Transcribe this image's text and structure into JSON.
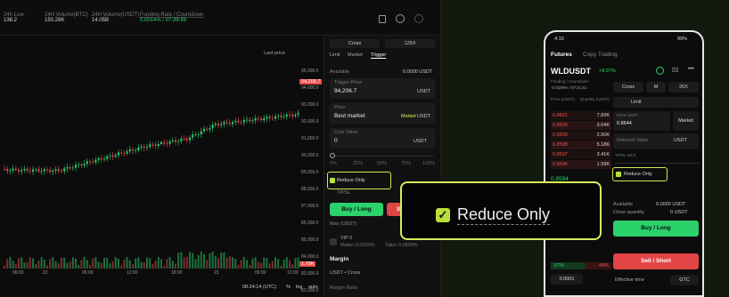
{
  "topbar": {
    "stats": [
      {
        "label": "24h Low",
        "value": "138.2"
      },
      {
        "label": "24H Volume(BTC)",
        "value": "150.28K"
      },
      {
        "label": "24H Volume(USDT)",
        "value": "14.05B"
      },
      {
        "label": "Funding Rate / Countdown",
        "value": "0.0014% / 07:39:48"
      }
    ]
  },
  "chart": {
    "price_type": "Last price",
    "y_ticks": [
      "95,000.0",
      "94,000.0",
      "93,000.0",
      "92,000.0",
      "91,000.0",
      "90,000.0",
      "89,000.0",
      "88,000.0",
      "87,000.0",
      "86,000.0",
      "85,000.0",
      "84,000.0",
      "83,000.0",
      "82,000.0"
    ],
    "last_price": "94,206.7",
    "x_ticks": [
      "06:00",
      "22",
      "06:00",
      "12:00",
      "18:00",
      "23",
      "06:00",
      "12:00"
    ],
    "vol_tag": "1.79K",
    "time_display": "08:24:14 (UTC)",
    "scale_opts": [
      "%",
      "log",
      "auto"
    ]
  },
  "order": {
    "margin_mode": "Cross",
    "leverage": "125X",
    "tabs": [
      "Limit",
      "Market",
      "Trigger"
    ],
    "available_label": "Available",
    "available_value": "0.0000 USDT",
    "trigger_label": "Trigger Price",
    "trigger_value": "94,206.7",
    "trigger_unit": "USDT",
    "price_label": "Price",
    "price_value": "Best market",
    "price_market": "Market",
    "price_unit": "USDT",
    "cost_label": "Cost Value",
    "cost_value": "0",
    "cost_unit": "USDT",
    "pct": [
      "0%",
      "25%",
      "50%",
      "75%",
      "100%"
    ],
    "reduce_only": "Reduce Only",
    "tpsl": "TP/SL",
    "buy_label": "Buy / Long",
    "sell_label": "Sell / Short",
    "max_label": "Max (USDT)",
    "vip_label": "VIP 0",
    "maker_fee": "Maker 0.0200%",
    "taker_fee": "Taker 0.0500%",
    "margin_title": "Margin",
    "margin_mode_line": "USDT • Cross",
    "margin_ratio": "Margin Ratio"
  },
  "zoom": {
    "text": "Reduce Only"
  },
  "phone": {
    "status_time": "4:19",
    "battery": "99%",
    "tabs": [
      "Futures",
      "Copy Trading"
    ],
    "pair": "WLDUSDT",
    "change": "+8.97%",
    "funding_label": "Funding / Countdown",
    "funding_value": "-0.0180% / 07:41:51",
    "mode": "Cross",
    "m": "M",
    "lev": "20X",
    "col_price": "Price (USDT)",
    "col_qty": "Quantity (USDT)",
    "order_type": "Limit",
    "asks": [
      {
        "p": "0.8601",
        "q": "7.83K"
      },
      {
        "p": "0.8600",
        "q": "3.04K"
      },
      {
        "p": "0.8599",
        "q": "2.50K"
      },
      {
        "p": "0.8598",
        "q": "5.18K"
      },
      {
        "p": "0.8597",
        "q": "3.41K"
      },
      {
        "p": "0.8596",
        "q": "1.59K"
      }
    ],
    "mid_price": "0.8594",
    "price_field_label": "Price USDT",
    "price_field_value": "0.8644",
    "market_btn": "Market",
    "notional_label": "Notional Value",
    "notional_unit": "USDT",
    "reduce_only": "Reduce Only",
    "tpsl": "TP/SL WLD",
    "available_label": "Available",
    "available_value": "0.0000 USDT",
    "close_qty_label": "Close quantity",
    "close_qty_value": "0 USDT",
    "buy_label": "Buy / Long",
    "sell_label": "Sell / Short",
    "ratio_buy": "57%",
    "ratio_sell": "44%",
    "bottom_val": "0.0001",
    "effective_label": "Effective time",
    "effective_value": "GTC"
  },
  "colors": {
    "accent": "#d6ee5a",
    "up": "#2dd36f",
    "down": "#ef4e4e"
  }
}
